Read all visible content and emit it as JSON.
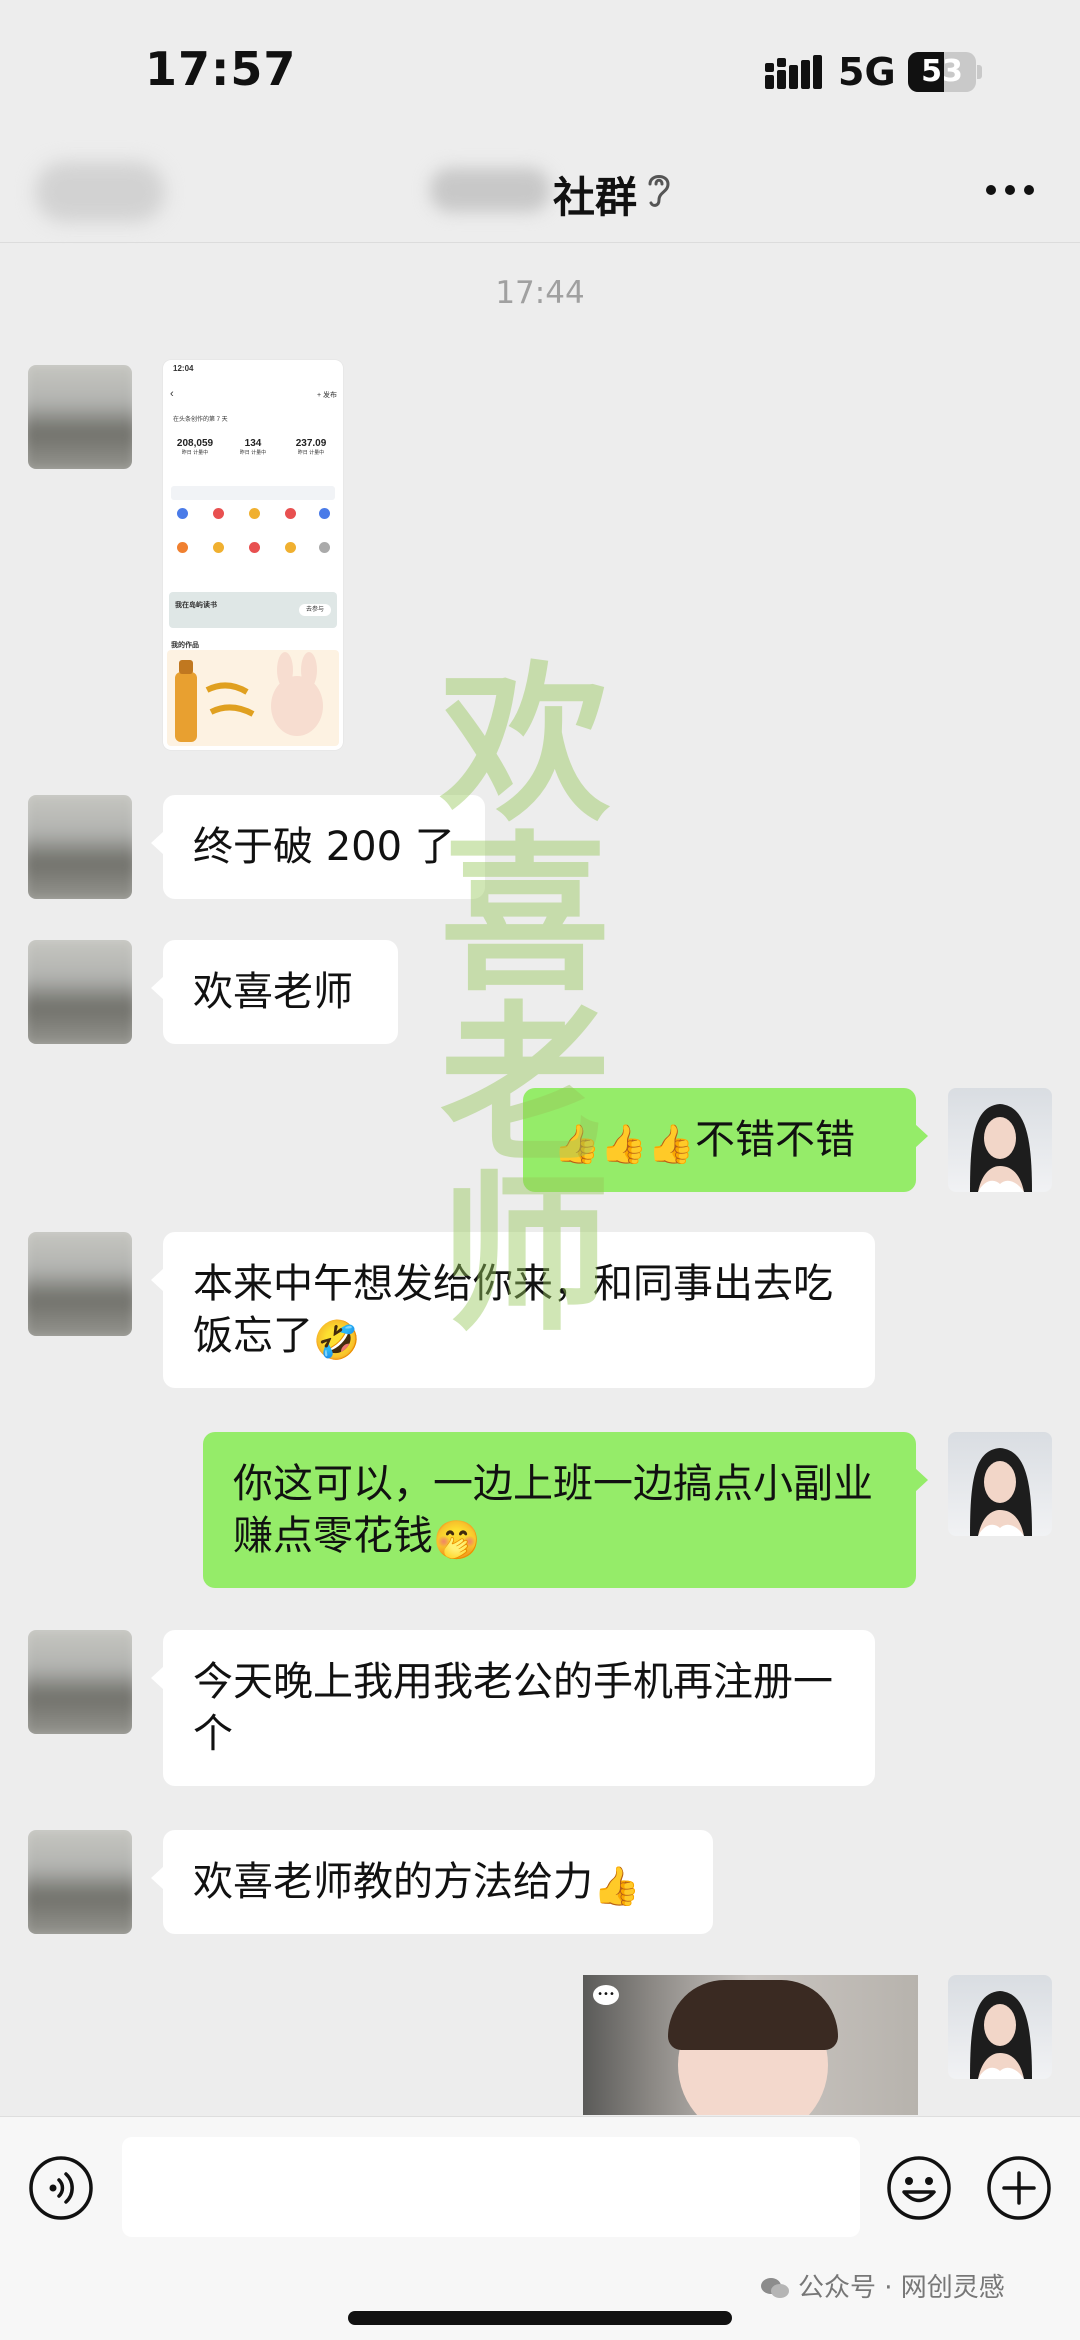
{
  "status_bar": {
    "time": "17:57",
    "network": "5G",
    "battery": "53",
    "battery_level": 0.53
  },
  "nav": {
    "title": "社群"
  },
  "chat": {
    "timestamp": "17:44",
    "messages": [
      {
        "side": "in",
        "type": "image"
      },
      {
        "side": "in",
        "text": "终于破 200 了"
      },
      {
        "side": "in",
        "text": "欢喜老师"
      },
      {
        "side": "out",
        "emoji": "👍👍👍",
        "text": "不错不错"
      },
      {
        "side": "in",
        "text": "本来中午想发给你来，和同事出去吃饭忘了",
        "emoji": "🤣"
      },
      {
        "side": "out",
        "text": "你这可以，一边上班一边搞点小副业赚点零花钱",
        "emoji": "🤭"
      },
      {
        "side": "in",
        "text": "今天晚上我用我老公的手机再注册一个"
      },
      {
        "side": "in",
        "text": "欢喜老师教的方法给力",
        "emoji": "👍"
      },
      {
        "side": "out",
        "type": "image"
      }
    ]
  },
  "screenshot_thumb": {
    "time": "12:04",
    "publish": "+ 发布",
    "user_line": "在头条创作的第 7 天",
    "stats": [
      {
        "value": "208,059",
        "label": "昨日 计量中"
      },
      {
        "value": "134",
        "label": "昨日 计量中"
      },
      {
        "value": "237.09",
        "label": "昨日 计量中"
      }
    ],
    "banner": "我在岛屿读书",
    "banner_button": "去参与",
    "works_label": "我的作品"
  },
  "watermark": [
    "欢",
    "喜",
    "老",
    "师"
  ],
  "input_bar": {
    "placeholder": ""
  },
  "footer": {
    "mark": "公众号 · 网创灵感"
  }
}
